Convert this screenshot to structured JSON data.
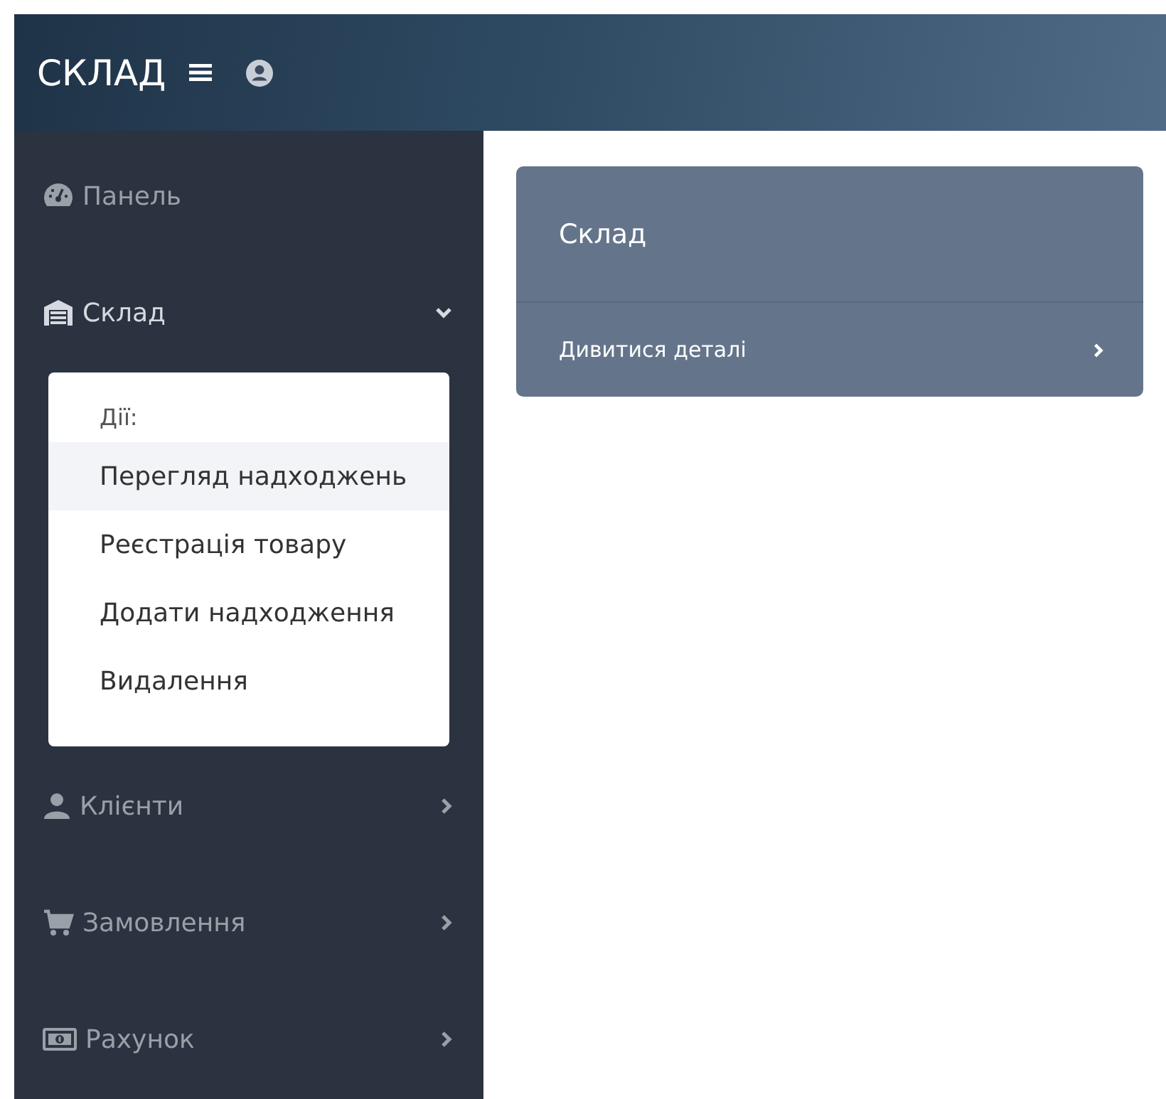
{
  "header": {
    "brand": "СКЛАД"
  },
  "sidebar": {
    "items": [
      {
        "label": "Панель",
        "expanded": false,
        "has_arrow": false
      },
      {
        "label": "Склад",
        "expanded": true,
        "has_arrow": true,
        "submenu": {
          "heading": "Дії:",
          "items": [
            {
              "label": "Перегляд надходжень",
              "selected": true
            },
            {
              "label": "Реєстрація товару",
              "selected": false
            },
            {
              "label": "Додати надходження",
              "selected": false
            },
            {
              "label": "Видалення",
              "selected": false
            }
          ]
        }
      },
      {
        "label": "Клієнти",
        "expanded": false,
        "has_arrow": true
      },
      {
        "label": "Замовлення",
        "expanded": false,
        "has_arrow": true
      },
      {
        "label": "Рахунок",
        "expanded": false,
        "has_arrow": true
      }
    ]
  },
  "card": {
    "title": "Склад",
    "link": "Дивитися деталі"
  }
}
